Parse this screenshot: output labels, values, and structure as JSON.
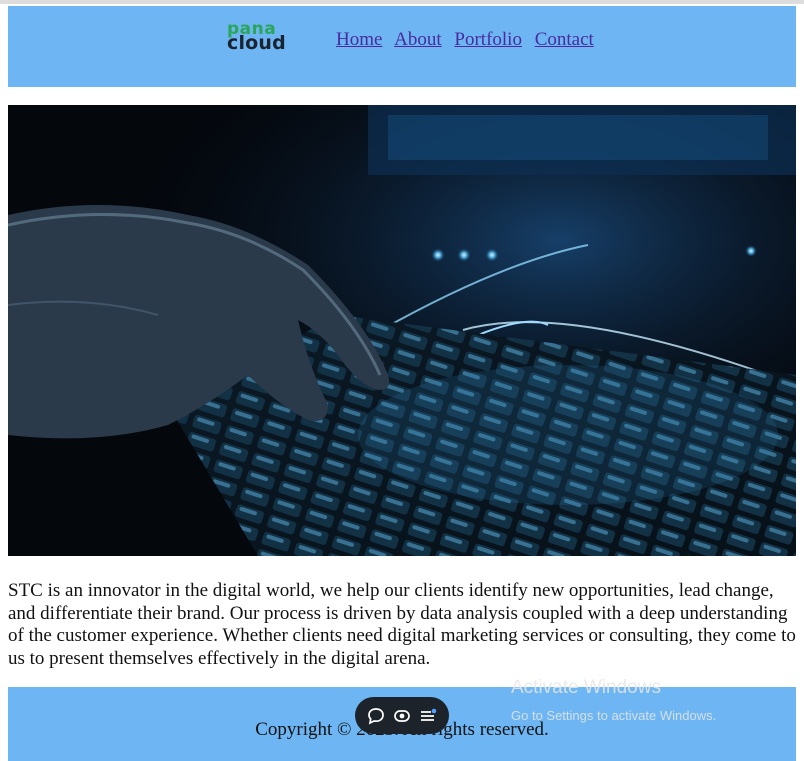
{
  "header": {
    "logo": {
      "top": "pana",
      "bottom": "cloud"
    },
    "nav": [
      "Home",
      "About",
      "Portfolio",
      "Contact"
    ]
  },
  "hero": {
    "icon": "keyboard-hands-photo"
  },
  "main": {
    "paragraph": "STC is an innovator in the digital world, we help our clients identify new opportunities, lead change, and differentiate their brand. Our process is driven by data analysis coupled with a deep understanding of the customer experience. Whether clients need digital marketing services or consulting, they come to us to present themselves effectively in the digital arena."
  },
  "footer": {
    "copyright": "Copyright © 2023. All rights reserved."
  },
  "overlay": {
    "watermark_title": "Activate Windows",
    "watermark_sub": "Go to Settings to activate Windows.",
    "toolbar_icons": [
      "chat-icon",
      "record-icon",
      "menu-icon"
    ]
  },
  "colors": {
    "header_bg": "#6db6f3",
    "footer_bg": "#6db6f3",
    "link": "#4b2a9c",
    "logo_green": "#2aa55a"
  }
}
